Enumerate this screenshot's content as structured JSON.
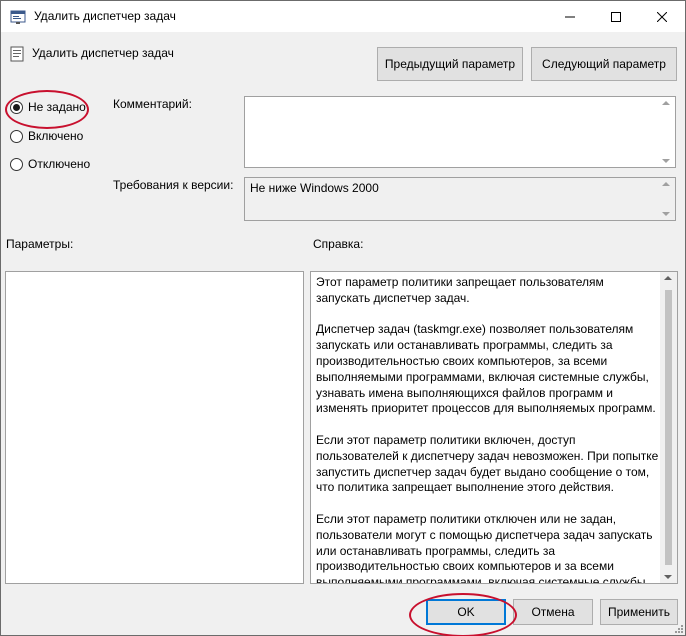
{
  "window": {
    "title": "Удалить диспетчер задач"
  },
  "policy": {
    "name": "Удалить диспетчер задач",
    "prev_button": "Предыдущий параметр",
    "next_button": "Следующий параметр"
  },
  "state": {
    "options": [
      {
        "label": "Не задано",
        "selected": true
      },
      {
        "label": "Включено",
        "selected": false
      },
      {
        "label": "Отключено",
        "selected": false
      }
    ]
  },
  "fields": {
    "comment_label": "Комментарий:",
    "comment_value": "",
    "version_label": "Требования к версии:",
    "version_value": "Не ниже Windows 2000"
  },
  "sections": {
    "params_label": "Параметры:",
    "help_label": "Справка:"
  },
  "help": {
    "paragraphs": [
      "Этот параметр политики запрещает пользователям запускать диспетчер задач.",
      "Диспетчер задач (taskmgr.exe) позволяет пользователям запускать или останавливать программы, следить за производительностью своих компьютеров, за всеми выполняемыми программами, включая системные службы, узнавать имена выполняющихся файлов программ и изменять приоритет процессов для выполняемых программ.",
      "Если этот параметр политики включен, доступ пользователей к диспетчеру задач невозможен. При попытке запустить диспетчер задач будет выдано сообщение о том, что политика запрещает выполнение этого действия.",
      "Если этот параметр политики отключен или не задан, пользователи могут с помощью диспетчера задач запускать или останавливать программы, следить за производительностью своих компьютеров и за всеми выполняемыми программами, включая системные службы, узнавать названия исполняемых файлов программ и"
    ]
  },
  "footer": {
    "ok": "OK",
    "cancel": "Отмена",
    "apply": "Применить"
  },
  "colors": {
    "annotation": "#c8102e",
    "focus_border": "#0078d7"
  }
}
